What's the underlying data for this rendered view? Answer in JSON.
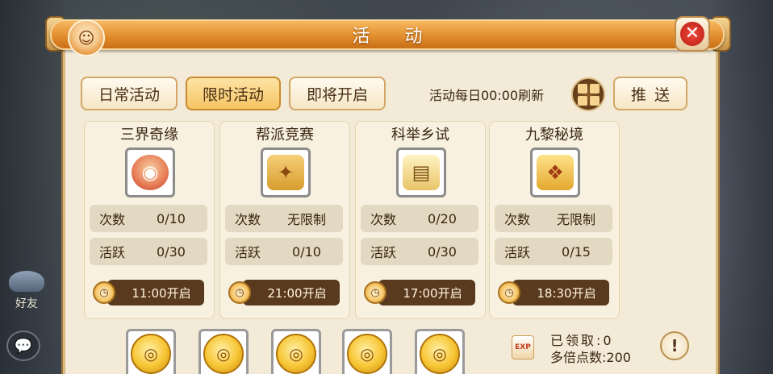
{
  "window": {
    "title": "活 动",
    "close_icon": "close-icon"
  },
  "scene": {
    "friends_label": "好友"
  },
  "tabs": [
    {
      "label": "日常活动",
      "active": false
    },
    {
      "label": "限时活动",
      "active": true
    },
    {
      "label": "即将开启",
      "active": false
    }
  ],
  "toolbar": {
    "refresh_text": "活动每日00:00刷新",
    "grid_icon": "grid-icon",
    "push_label": "推送"
  },
  "activities": [
    {
      "name": "三界奇缘",
      "icon": "bowl-icon",
      "times_label": "次数",
      "times_value": "0/10",
      "active_label": "活跃",
      "active_value": "0/30",
      "open_time": "11:00开启"
    },
    {
      "name": "帮派竞赛",
      "icon": "medal-icon",
      "times_label": "次数",
      "times_value": "无限制",
      "active_label": "活跃",
      "active_value": "0/10",
      "open_time": "21:00开启"
    },
    {
      "name": "科举乡试",
      "icon": "scroll-icon",
      "times_label": "次数",
      "times_value": "0/20",
      "active_label": "活跃",
      "active_value": "0/30",
      "open_time": "17:00开启"
    },
    {
      "name": "九黎秘境",
      "icon": "charm-icon",
      "times_label": "次数",
      "times_value": "无限制",
      "active_label": "活跃",
      "active_value": "0/15",
      "open_time": "18:30开启"
    }
  ],
  "rewards": {
    "chest_icon": "gold-coin-icon",
    "count": 5,
    "claimed_text": "已领取:0",
    "multiplier_text": "多倍点数:200",
    "info_icon": "exclamation-icon"
  },
  "colors": {
    "title_bar": "#e08a2a",
    "panel_bg": "#f3ead7",
    "active_tab": "#f6c464",
    "time_pill": "#5a3a1e",
    "close_red": "#d42a1e"
  }
}
